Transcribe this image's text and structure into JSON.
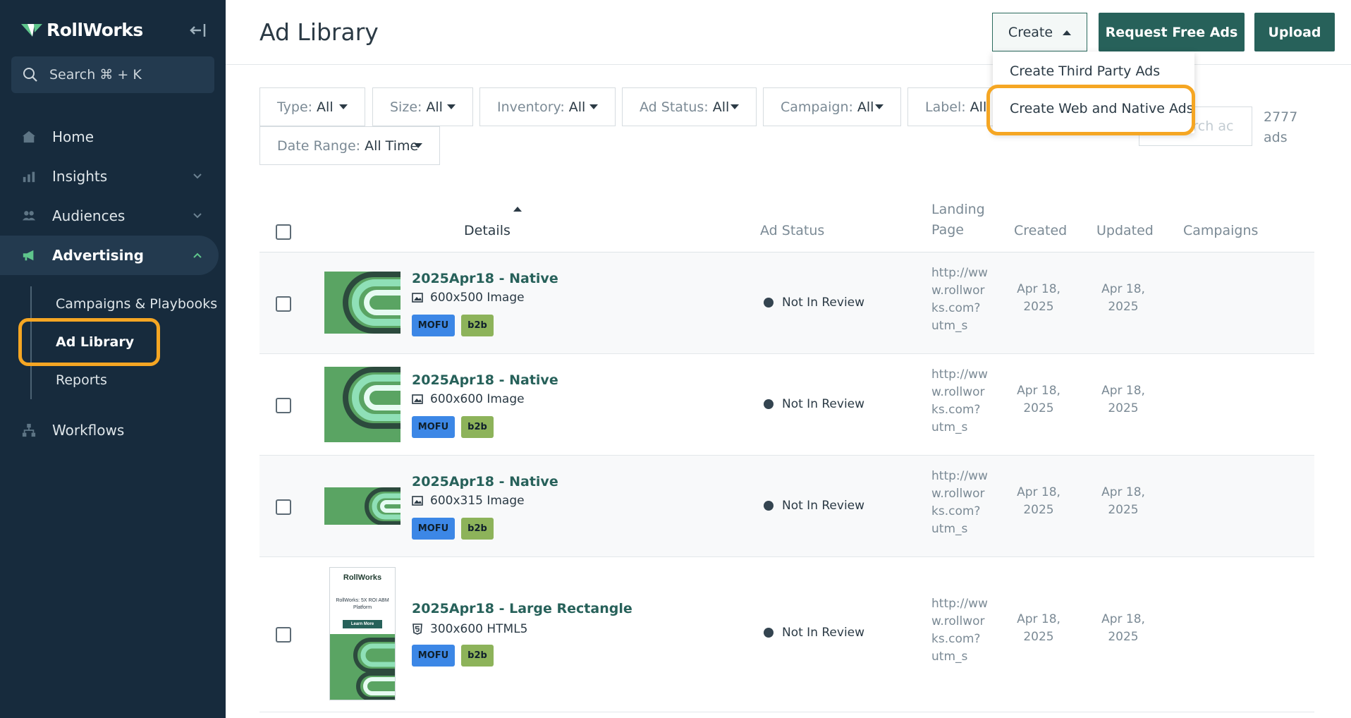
{
  "sidebar": {
    "brand": "RollWorks",
    "search_label": "Search ⌘ + K",
    "nav": {
      "home": "Home",
      "insights": "Insights",
      "audiences": "Audiences",
      "advertising": "Advertising",
      "workflows": "Workflows"
    },
    "subnav": {
      "campaigns": "Campaigns & Playbooks",
      "ad_library": "Ad Library",
      "reports": "Reports"
    }
  },
  "header": {
    "title": "Ad Library",
    "create_label": "Create",
    "request_label": "Request Free Ads",
    "upload_label": "Upload"
  },
  "create_menu": {
    "item1": "Create Third Party Ads",
    "item2": "Create Web and Native Ads"
  },
  "filters": {
    "type": {
      "label": "Type:",
      "value": "All"
    },
    "size": {
      "label": "Size:",
      "value": "All"
    },
    "inventory": {
      "label": "Inventory:",
      "value": "All"
    },
    "ad_status": {
      "label": "Ad Status:",
      "value": "All"
    },
    "campaign": {
      "label": "Campaign:",
      "value": "All"
    },
    "label": {
      "label": "Label:",
      "value": "All"
    },
    "date_range": {
      "label": "Date Range:",
      "value": "All Time"
    },
    "search_placeholder": "Search ac",
    "count_num": "2777",
    "count_unit": "ads"
  },
  "table": {
    "headers": {
      "details": "Details",
      "ad_status": "Ad Status",
      "landing_page": "Landing Page",
      "created": "Created",
      "updated": "Updated",
      "campaigns": "Campaigns"
    },
    "rows": [
      {
        "title": "2025Apr18 - Native",
        "meta": "600x500 Image",
        "tag1": "MOFU",
        "tag2": "b2b",
        "status": "Not In Review",
        "url": "http://www.rollworks.com?utm_s",
        "created": "Apr 18, 2025",
        "updated": "Apr 18, 2025"
      },
      {
        "title": "2025Apr18 - Native",
        "meta": "600x600 Image",
        "tag1": "MOFU",
        "tag2": "b2b",
        "status": "Not In Review",
        "url": "http://www.rollworks.com?utm_s",
        "created": "Apr 18, 2025",
        "updated": "Apr 18, 2025"
      },
      {
        "title": "2025Apr18 - Native",
        "meta": "600x315 Image",
        "tag1": "MOFU",
        "tag2": "b2b",
        "status": "Not In Review",
        "url": "http://www.rollworks.com?utm_s",
        "created": "Apr 18, 2025",
        "updated": "Apr 18, 2025"
      },
      {
        "title": "2025Apr18 - Large Rectangle",
        "meta": "300x600 HTML5",
        "tag1": "MOFU",
        "tag2": "b2b",
        "status": "Not In Review",
        "url": "http://www.rollworks.com?utm_s",
        "created": "Apr 18, 2025",
        "updated": "Apr 18, 2025"
      }
    ]
  },
  "banner_preview": {
    "brand": "RollWorks",
    "headline": "RollWorks: 5X ROI ABM Platform",
    "cta": "Learn More"
  },
  "colors": {
    "sidebar_bg": "#172b3d",
    "accent_green": "#27615a",
    "highlight_orange": "#f5a623",
    "tag_mofu": "#3c87e6",
    "tag_b2b": "#8db35a"
  },
  "icons": [
    "rollworks-logo-icon",
    "collapse-sidebar-icon",
    "search-icon",
    "home-icon",
    "insights-icon",
    "audiences-icon",
    "megaphone-icon",
    "workflows-icon",
    "chevron-down-icon",
    "chevron-up-icon",
    "caret-down-icon",
    "caret-up-icon",
    "image-icon",
    "html5-icon",
    "sort-up-icon"
  ]
}
